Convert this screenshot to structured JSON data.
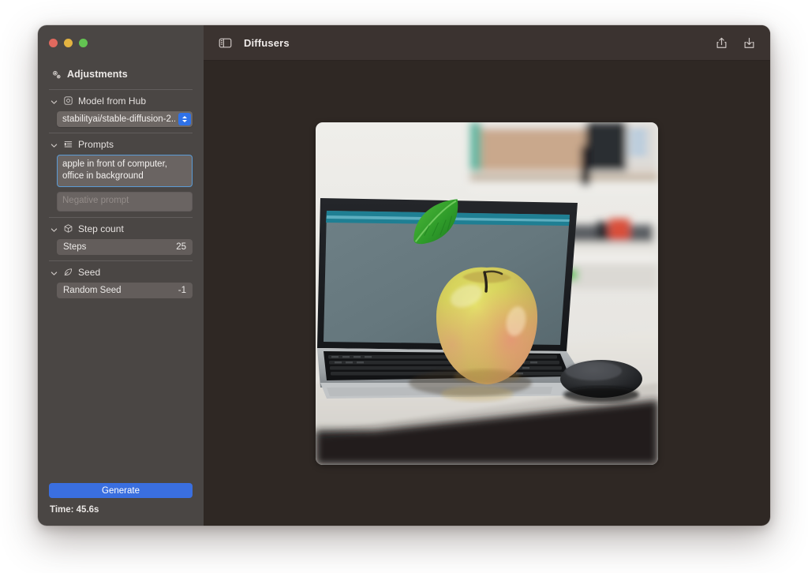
{
  "window": {
    "traffic_lights": [
      "close",
      "minimize",
      "zoom"
    ],
    "title": "Diffusers"
  },
  "titlebar": {
    "sidebar_toggle_icon": "sidebar-toggle-icon",
    "title": "Diffusers",
    "share_icon": "share-icon",
    "download_icon": "download-icon"
  },
  "sidebar": {
    "header": {
      "icon": "gears-icon",
      "label": "Adjustments"
    },
    "sections": [
      {
        "id": "model-from-hub",
        "icon": "model-icon",
        "label": "Model from Hub",
        "expanded": true,
        "control": {
          "type": "dropdown",
          "value": "stabilityai/stable-diffusion-2..."
        }
      },
      {
        "id": "prompts",
        "icon": "text-align-icon",
        "label": "Prompts",
        "expanded": true,
        "prompt": {
          "value": "apple in front of computer, office in background",
          "focused": true
        },
        "negative_prompt": {
          "value": "",
          "placeholder": "Negative prompt"
        }
      },
      {
        "id": "step-count",
        "icon": "cube-icon",
        "label": "Step count",
        "expanded": true,
        "control": {
          "type": "value-row",
          "label": "Steps",
          "value": "25"
        }
      },
      {
        "id": "seed",
        "icon": "seed-icon",
        "label": "Seed",
        "expanded": true,
        "control": {
          "type": "value-row",
          "label": "Random Seed",
          "value": "-1"
        }
      }
    ],
    "generate_button": "Generate",
    "status": "Time: 45.6s"
  },
  "canvas": {
    "image_description": "Generated image: a yellow-red apple with a green leaf resting on an open laptop keyboard, blurred office background with a mouse and desk"
  },
  "colors": {
    "accent": "#3a6fe0",
    "focus_ring": "#5b9bd5",
    "sidebar_bg": "#4a4644",
    "main_bg": "#2f2824",
    "titlebar_bg": "#3b3330",
    "field_bg": "#6a6462",
    "page_bg": "#ffffff"
  }
}
